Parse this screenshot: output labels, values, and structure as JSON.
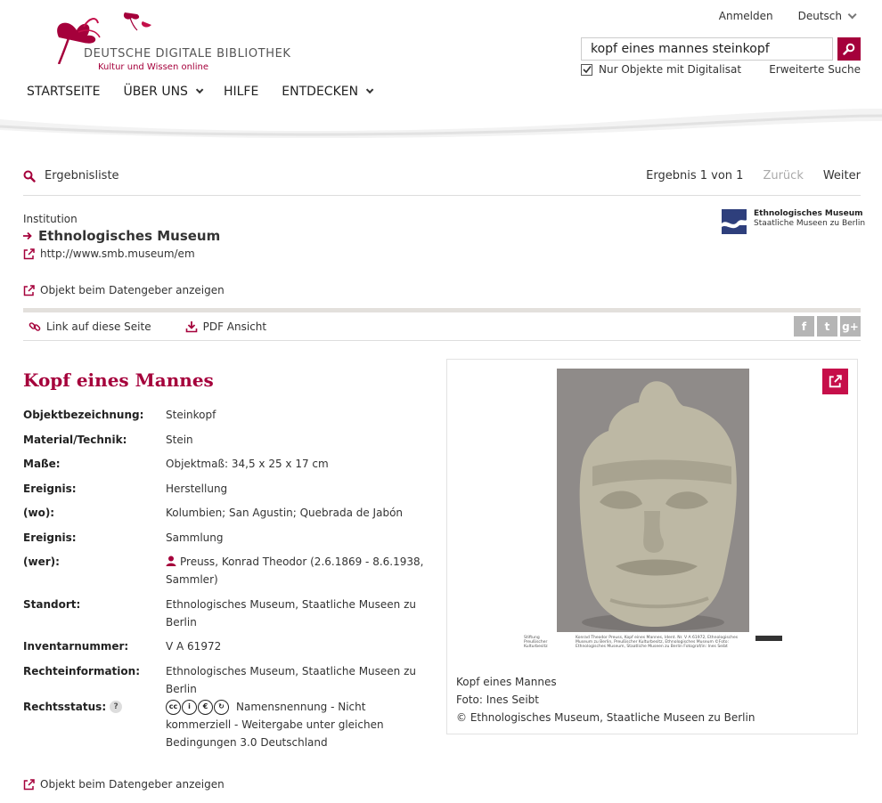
{
  "brand": {
    "title": "DEUTSCHE DIGITALE BIBLIOTHEK",
    "subtitle": "Kultur und Wissen online",
    "accent": "#a5003b"
  },
  "top": {
    "login": "Anmelden",
    "language": "Deutsch"
  },
  "search": {
    "value": "kopf eines mannes steinkopf",
    "only_digital_label": "Nur Objekte mit Digitalisat",
    "only_digital_checked": true,
    "advanced": "Erweiterte Suche"
  },
  "nav": {
    "home": "STARTSEITE",
    "about": "ÜBER UNS",
    "help": "HILFE",
    "explore": "ENTDECKEN"
  },
  "results": {
    "back_label": "Ergebnisliste",
    "count": "Ergebnis 1 von 1",
    "prev": "Zurück",
    "next": "Weiter"
  },
  "institution": {
    "label": "Institution",
    "name": "Ethnologisches Museum",
    "url": "http://www.smb.museum/em",
    "logo_line1": "Ethnologisches Museum",
    "logo_line2": "Staatliche Museen zu Berlin"
  },
  "object_link": "Objekt beim Datengeber anzeigen",
  "toolbar": {
    "link": "Link auf diese Seite",
    "pdf": "PDF Ansicht"
  },
  "social": {
    "facebook": "f",
    "twitter": "t",
    "gplus": "g+"
  },
  "object": {
    "title": "Kopf eines Mannes",
    "fields": [
      {
        "key": "Objektbezeichnung:",
        "value": "Steinkopf"
      },
      {
        "key": "Material/Technik:",
        "value": "Stein"
      },
      {
        "key": "Maße:",
        "value": "Objektmaß: 34,5 x 25 x 17 cm"
      },
      {
        "key": "Ereignis:",
        "value": "Herstellung"
      },
      {
        "key": "(wo):",
        "value": "Kolumbien; San Agustin; Quebrada de Jabón"
      },
      {
        "key": "Ereignis:",
        "value": "Sammlung"
      },
      {
        "key": "(wer):",
        "value": "Preuss, Konrad Theodor (2.6.1869 - 8.6.1938, Sammler)"
      },
      {
        "key": "Standort:",
        "value": "Ethnologisches Museum, Staatliche Museen zu Berlin"
      },
      {
        "key": "Inventarnummer:",
        "value": "V A 61972"
      },
      {
        "key": "Rechteinformation:",
        "value": "Ethnologisches Museum, Staatliche Museen zu Berlin"
      },
      {
        "key": "Rechtsstatus:",
        "value": "Namensnennung - Nicht kommerziell - Weitergabe unter gleichen Bedingungen 3.0 Deutschland"
      }
    ],
    "help_icon": "?"
  },
  "image": {
    "caption_title": "Kopf eines Mannes",
    "caption_photo": "Foto: Ines Seibt",
    "caption_copyright": "© Ethnologisches Museum, Staatliche Museen zu Berlin",
    "strip_left": "Stiftung Preußischer Kulturbesitz",
    "strip_text": "Konrad Theodor Preuss, Kopf eines Mannes, Ident. Nr. V A 61972, Ethnologisches Museum zu Berlin, Preußischer Kulturbesitz, Ethnologisches Museum ©Foto: Ethnologisches Museum, Staatliche Museen zu Berlin Fotograf/in: Ines Seibt"
  }
}
